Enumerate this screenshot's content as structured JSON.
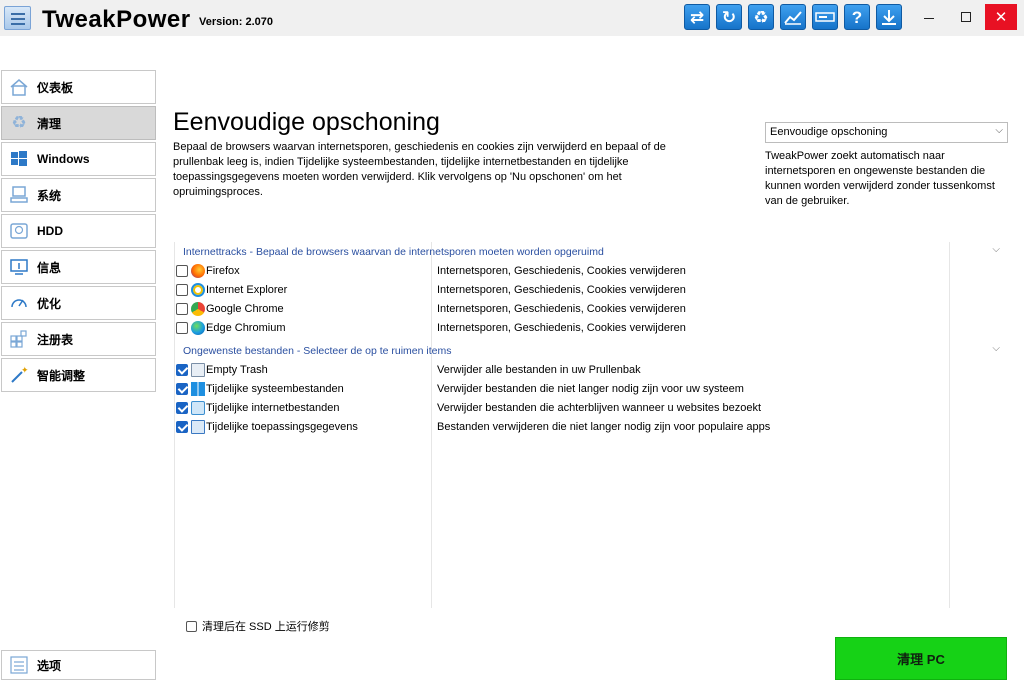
{
  "app": {
    "title": "TweakPower",
    "version": "Version: 2.070"
  },
  "toolbar": {
    "icons": [
      "refresh-arrows-icon",
      "redo-icon",
      "recycle-icon",
      "chart-icon",
      "drive-icon",
      "help-icon",
      "download-icon"
    ],
    "help_glyph": "?"
  },
  "window": {
    "close_glyph": "✕"
  },
  "sidebar": {
    "items": [
      {
        "label": "仪表板",
        "icon": "home-icon"
      },
      {
        "label": "清理",
        "icon": "recycle-icon"
      },
      {
        "label": "Windows",
        "icon": "windows-icon"
      },
      {
        "label": "系统",
        "icon": "system-icon"
      },
      {
        "label": "HDD",
        "icon": "hdd-icon"
      },
      {
        "label": "信息",
        "icon": "monitor-info-icon"
      },
      {
        "label": "优化",
        "icon": "speedometer-icon"
      },
      {
        "label": "注册表",
        "icon": "registry-icon"
      },
      {
        "label": "智能调整",
        "icon": "magic-wand-icon"
      }
    ],
    "options_label": "选项"
  },
  "main": {
    "title": "Eenvoudige opschoning",
    "description": "Bepaal de browsers waarvan internetsporen, geschiedenis en cookies zijn verwijderd en bepaal of de prullenbak leeg is, indien Tijdelijke systeembestanden, tijdelijke internetbestanden en tijdelijke toepassingsgegevens moeten worden verwijderd. Klik vervolgens op 'Nu opschonen' om het opruimingsproces.",
    "mode_select": "Eenvoudige opschoning",
    "mode_description": "TweakPower zoekt automatisch naar internetsporen en ongewenste bestanden die kunnen worden verwijderd zonder tussenkomst van de gebruiker."
  },
  "groups": [
    {
      "header": "Internettracks - Bepaal de browsers waarvan de internetsporen moeten worden opgeruimd",
      "items": [
        {
          "name": "Firefox",
          "desc": "Internetsporen, Geschiedenis, Cookies verwijderen",
          "checked": false,
          "icon": "firefox-icon"
        },
        {
          "name": "Internet Explorer",
          "desc": "Internetsporen, Geschiedenis, Cookies verwijderen",
          "checked": false,
          "icon": "internet-explorer-icon"
        },
        {
          "name": "Google Chrome",
          "desc": "Internetsporen, Geschiedenis, Cookies verwijderen",
          "checked": false,
          "icon": "chrome-icon"
        },
        {
          "name": "Edge Chromium",
          "desc": "Internetsporen, Geschiedenis, Cookies verwijderen",
          "checked": false,
          "icon": "edge-icon"
        }
      ]
    },
    {
      "header": "Ongewenste bestanden - Selecteer de op te ruimen items",
      "items": [
        {
          "name": "Empty Trash",
          "desc": "Verwijder alle bestanden in uw Prullenbak",
          "checked": true,
          "icon": "trash-icon"
        },
        {
          "name": "Tijdelijke systeembestanden",
          "desc": "Verwijder bestanden die niet langer nodig zijn voor uw systeem",
          "checked": true,
          "icon": "windows-icon"
        },
        {
          "name": "Tijdelijke internetbestanden",
          "desc": "Verwijder bestanden die achterblijven wanneer u websites bezoekt",
          "checked": true,
          "icon": "internet-files-icon"
        },
        {
          "name": "Tijdelijke toepassingsgegevens",
          "desc": "Bestanden verwijderen die niet langer nodig zijn voor populaire apps",
          "checked": true,
          "icon": "app-data-icon"
        }
      ]
    }
  ],
  "ssd_option": {
    "label": "清理后在 SSD 上运行修剪",
    "checked": false
  },
  "action": {
    "label": "清理 PC"
  },
  "colors": {
    "accent": "#1673c9",
    "clean_button": "#16d216",
    "group_header": "#2a4fa0",
    "close": "#e81123"
  }
}
